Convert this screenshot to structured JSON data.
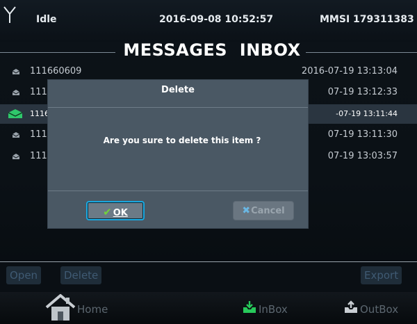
{
  "status": {
    "state": "Idle",
    "datetime": "2016-09-08 10:52:57",
    "mmsi": "MMSI 179311383"
  },
  "title": "MESSAGES  INBOX",
  "messages": [
    {
      "num": "111660609",
      "date": "2016-07-19 13:13:04",
      "selected": false
    },
    {
      "num": "111",
      "date": "07-19 13:12:33",
      "selected": false
    },
    {
      "num": "1116",
      "date": "-07-19 13:11:44",
      "selected": true
    },
    {
      "num": "111",
      "date": "07-19 13:11:30",
      "selected": false
    },
    {
      "num": "111",
      "date": "07-19 13:03:57",
      "selected": false
    }
  ],
  "dialog": {
    "title": "Delete",
    "message": "Are you sure to delete this item ?",
    "ok_label": "OK",
    "cancel_label": "Cancel"
  },
  "actions": {
    "open": "Open",
    "delete": "Delete",
    "export": "Export"
  },
  "nav": {
    "home": "Home",
    "inbox": "InBox",
    "outbox": "OutBox"
  },
  "colors": {
    "accent": "#1aa7df",
    "ok_check": "#72d23c",
    "selected_mail": "#2fc86b",
    "inbox_icon": "#27c95a"
  },
  "icons": [
    "antenna-icon",
    "mail-icon",
    "check-icon",
    "x-icon",
    "home-icon",
    "inbox-icon",
    "outbox-icon"
  ]
}
